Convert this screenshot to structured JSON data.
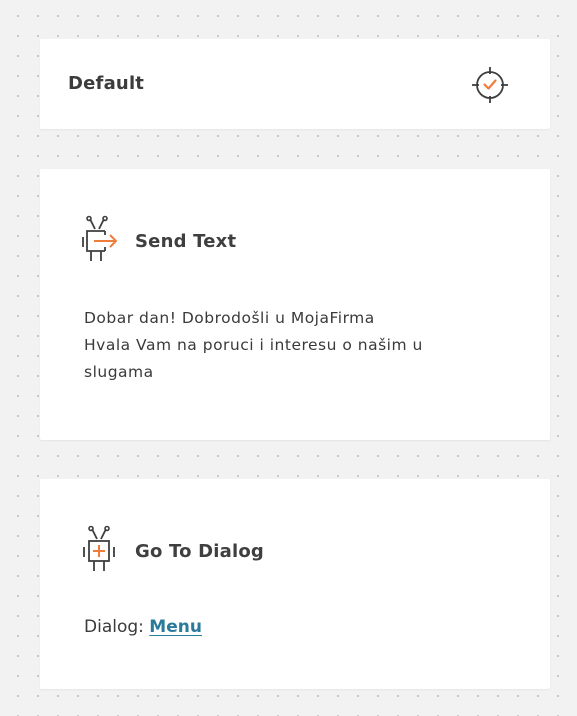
{
  "flow": {
    "default_card": {
      "title": "Default",
      "target_icon": "target-check-icon"
    },
    "send_text_card": {
      "title": "Send Text",
      "icon": "robot-send-icon",
      "message": "Dobar dan! Dobrodošli u MojaFirma\nHvala Vam na poruci i interesu o našim u\nslugama"
    },
    "go_to_dialog_card": {
      "title": "Go To Dialog",
      "icon": "robot-plus-icon",
      "dialog_label": "Dialog:",
      "dialog_link": "Menu"
    }
  },
  "colors": {
    "background": "#f2f2f2",
    "card": "#ffffff",
    "accent_orange": "#f07c3c",
    "link_blue": "#2a7a9b",
    "text": "#3f3f3f"
  }
}
